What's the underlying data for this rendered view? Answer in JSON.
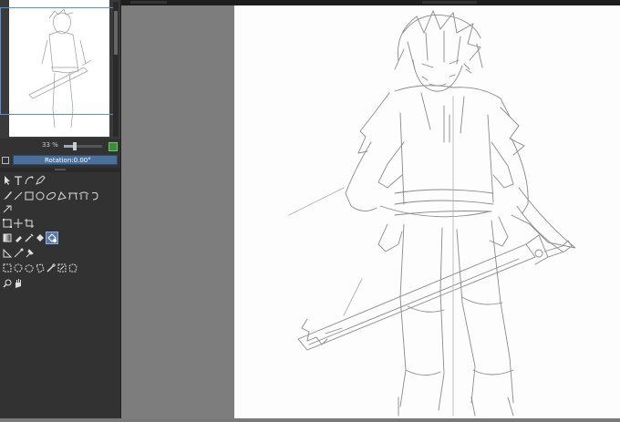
{
  "navigator": {
    "zoom_label": "33 %",
    "rotation_label": "Rotation",
    "rotation_value": ":0.00°"
  },
  "tools": [
    [
      "pointer-icon",
      "text-icon",
      "pen-curve-icon",
      "pen-icon"
    ],
    [
      "brush-icon",
      "line-icon",
      "rect-icon",
      "ellipse-icon",
      "polygon-icon",
      "polyline-icon",
      "bezier-icon",
      "freehand-path-icon"
    ],
    [
      "multibrush-icon"
    ],
    [
      "transform-icon",
      "move-icon",
      "crop-icon"
    ],
    [
      "gradient-icon",
      "color-picker-icon",
      "fill-icon",
      "reference-icon",
      "selected-tool-icon"
    ],
    [
      "measure-icon",
      "assistant-icon"
    ],
    [
      "rect-select-icon",
      "ellipse-select-icon",
      "freehand-select-icon",
      "polygon-select-icon",
      "magic-wand-icon",
      "similar-select-icon",
      "bezier-select-icon"
    ],
    [
      "zoom-icon",
      "pan-icon"
    ]
  ]
}
